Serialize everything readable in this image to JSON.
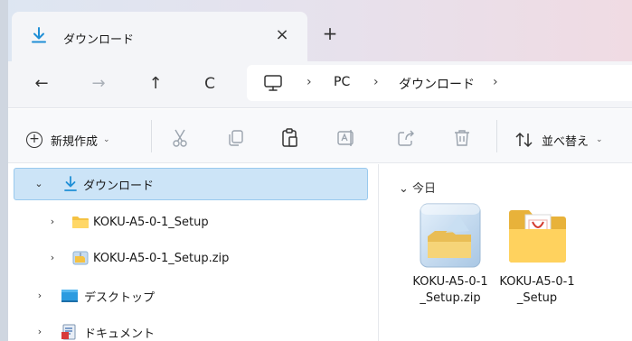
{
  "tab": {
    "title": "ダウンロード",
    "close_label": "×",
    "new_tab_label": "+"
  },
  "nav": {
    "back": "←",
    "forward": "→",
    "up": "↑",
    "refresh": "C",
    "breadcrumb": [
      "PC",
      "ダウンロード"
    ],
    "separator": "›"
  },
  "commands": {
    "new_label": "新規作成",
    "new_chevron": "⌄",
    "sort_label": "並べ替え",
    "sort_chevron": "⌄"
  },
  "tree": {
    "items": [
      {
        "label": "ダウンロード",
        "chevron": "⌄",
        "icon": "download-arrow-icon",
        "selected": true
      },
      {
        "label": "KOKU-A5-0-1_Setup",
        "chevron": "›",
        "icon": "folder-icon"
      },
      {
        "label": "KOKU-A5-0-1_Setup.zip",
        "chevron": "›",
        "icon": "zip-folder-icon"
      },
      {
        "label": "デスクトップ",
        "chevron": "›",
        "icon": "desktop-icon"
      },
      {
        "label": "ドキュメント",
        "chevron": "›",
        "icon": "documents-icon"
      }
    ]
  },
  "content": {
    "group_header": "⌄ 今日",
    "items": [
      {
        "label": "KOKU-A5-0-1_Setup.zip",
        "icon": "zip-archive-icon"
      },
      {
        "label": "KOKU-A5-0-1_Setup",
        "icon": "folder-pdf-icon"
      }
    ]
  },
  "colors": {
    "accent": "#0067c0",
    "selection": "#cce4f7",
    "folder": "#f5c242"
  }
}
